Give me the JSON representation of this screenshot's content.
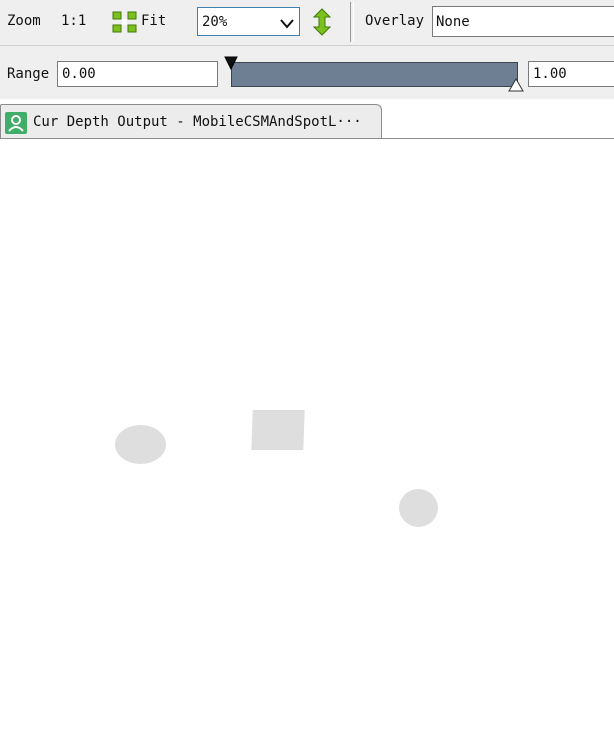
{
  "toolbar": {
    "zoom_label": "Zoom",
    "one_to_one_label": "1:1",
    "fit_label": "Fit",
    "zoom_value": "20%",
    "overlay_label": "Overlay",
    "overlay_value": "None",
    "icons": {
      "fit": "fit-to-window-icon",
      "dropdown": "chevron-down-icon",
      "flip": "vertical-flip-icon"
    },
    "accent_color": "#7cc01e"
  },
  "range": {
    "label": "Range",
    "min_value": "0.00",
    "max_value": "1.00",
    "track_color": "#6f7f93"
  },
  "tabs": [
    {
      "label": "Cur Depth Output - MobileCSMAndSpotL···",
      "icon": "texture-viewer-icon",
      "icon_color": "#3fae69"
    }
  ],
  "viewport": {
    "background": "#ffffff",
    "shape_color": "#dedede"
  }
}
